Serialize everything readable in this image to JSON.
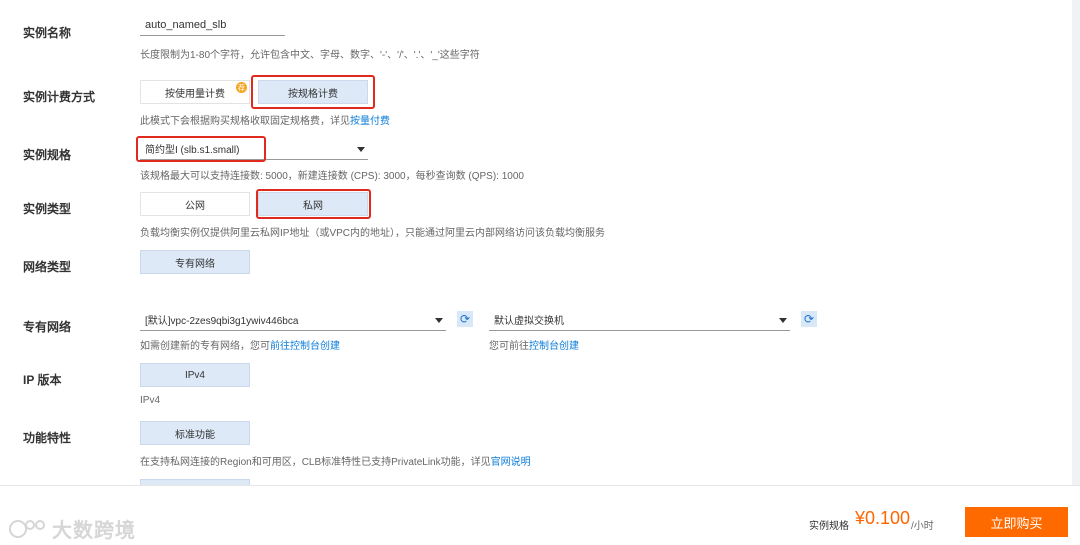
{
  "form": {
    "name": {
      "label": "实例名称",
      "value": "auto_named_slb",
      "hint": "长度限制为1-80个字符，允许包含中文、字母、数字、'-'、'/'、'.'、'_'这些字符"
    },
    "billing": {
      "label": "实例计费方式",
      "options": [
        "按使用量计费",
        "按规格计费"
      ],
      "selected": "按规格计费",
      "badge": "荐",
      "hint_prefix": "此模式下会根据购买规格收取固定规格费，详见",
      "hint_link": "按量付费"
    },
    "spec": {
      "label": "实例规格",
      "value": "简约型I (slb.s1.small)",
      "hint": "该规格最大可以支持连接数: 5000，新建连接数 (CPS): 3000，每秒查询数 (QPS): 1000"
    },
    "type": {
      "label": "实例类型",
      "options": [
        "公网",
        "私网"
      ],
      "selected": "私网",
      "hint": "负载均衡实例仅提供阿里云私网IP地址（或VPC内的地址），只能通过阿里云内部网络访问该负载均衡服务"
    },
    "network_type": {
      "label": "网络类型",
      "option": "专有网络"
    },
    "vpc": {
      "label": "专有网络",
      "vpc_value": "[默认]vpc-2zes9qbi3g1ywiv446bca",
      "vswitch_value": "默认虚拟交换机",
      "vpc_hint_prefix": "如需创建新的专有网络，您可",
      "vpc_hint_link": "前往控制台创建",
      "vswitch_hint_prefix": "您可前往",
      "vswitch_hint_link": "控制台创建"
    },
    "ip_version": {
      "label": "IP 版本",
      "option": "IPv4",
      "hint": "IPv4"
    },
    "features": {
      "label": "功能特性",
      "option": "标准功能",
      "hint_prefix": "在支持私网连接的Region和可用区，CLB标准特性已支持PrivateLink功能，详见",
      "hint_link": "官网说明"
    }
  },
  "footer": {
    "spec_label": "实例规格",
    "price": "¥0.100",
    "unit": "/小时",
    "buy_label": "立即购买"
  },
  "watermark": {
    "text": "大数跨境"
  },
  "colors": {
    "selected_bg": "#dde9f7",
    "highlight_border": "#e02a1f",
    "link": "#0a7cd9",
    "price": "#ff6600",
    "buy_button": "#ff6a00"
  }
}
